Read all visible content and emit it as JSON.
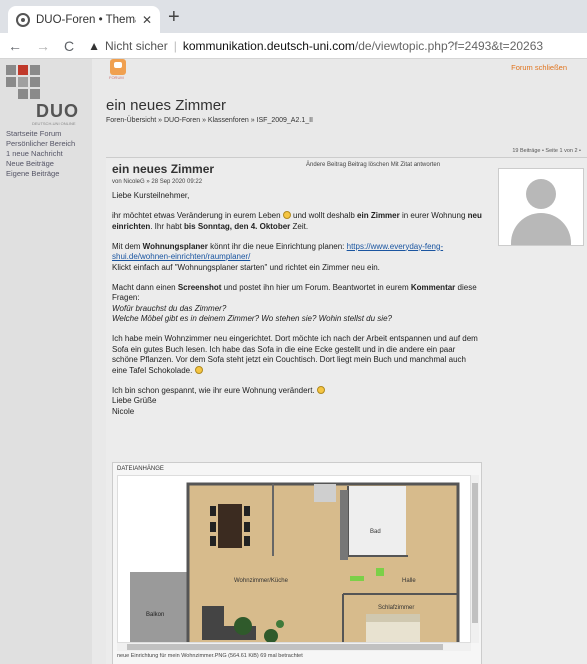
{
  "browser": {
    "tab_title": "DUO-Foren • Thema anzeigen - e",
    "tab_close": "✕",
    "new_tab": "+",
    "back": "←",
    "forward": "→",
    "reload": "C",
    "security_icon": "▲",
    "not_secure": "Nicht sicher",
    "separator": "|",
    "url_host": "kommunikation.deutsch-uni.com",
    "url_path": "/de/viewtopic.php?f=2493&t=20263"
  },
  "sidebar": {
    "logo_text": "DUO",
    "logo_sub": "DEUTSCH-UNI ONLINE",
    "items": [
      "Startseite Forum",
      "Persönlicher Bereich",
      "1 neue Nachricht",
      "Neue Beiträge",
      "Eigene Beiträge"
    ]
  },
  "header": {
    "forum_icon_label": "FORUM",
    "forum_close": "Forum schließen",
    "page_title": "ein neues Zimmer",
    "breadcrumb": "Foren-Übersicht » DUO-Foren » Klassenforen » ISF_2009_A2.1_II",
    "posts_count": "19 Beiträge • Seite 1 von 2 •"
  },
  "post": {
    "title": "ein neues Zimmer",
    "actions": "Ändere Beitrag Beitrag löschen   Mit Zitat antworten",
    "meta": "von NicoleG » 28 Sep 2020 09:22",
    "greeting": "Liebe Kursteilnehmer,",
    "p1_a": "ihr möchtet etwas Veränderung in eurem Leben ",
    "p1_b": " und wollt deshalb ",
    "p1_b_bold": "ein Zimmer",
    "p1_c": " in eurer Wohnung ",
    "p1_c_bold": "neu einrichten",
    "p1_d": ". Ihr habt ",
    "p1_d_bold": "bis Sonntag, den 4. Oktober",
    "p1_e": " Zeit.",
    "p2_a": "Mit dem ",
    "p2_bold": "Wohnungsplaner",
    "p2_b": " könnt ihr die neue Einrichtung planen: ",
    "p2_link": "https://www.everyday-feng-shui.de/wohnen-einrichten/raumplaner/",
    "p2_c": "Klickt einfach auf \"Wohnungsplaner starten\" und richtet ein Zimmer neu ein.",
    "p3_a": "Macht dann einen ",
    "p3_bold": "Screenshot",
    "p3_b": " und postet ihn hier um Forum. Beantwortet in eurem ",
    "p3_bold2": "Kommentar",
    "p3_c": " diese Fragen:",
    "p3_q1": "Wofür brauchst du das Zimmer?",
    "p3_q2": "Welche Möbel gibt es in deinem Zimmer? Wo stehen sie? Wohin stellst du sie?",
    "p4": "Ich habe mein Wohnzimmer neu eingerichtet. Dort möchte ich nach der Arbeit entspannen und auf dem Sofa ein gutes Buch lesen. Ich habe das Sofa in die eine Ecke gestellt und in die andere ein paar schöne Pflanzen. Vor dem Sofa steht jetzt ein Couchtisch. Dort liegt mein Buch und manchmal auch eine Tafel Schokolade. ",
    "p5": "Ich bin schon gespannt, wie ihr eure Wohnung verändert. ",
    "closing": "Liebe Grüße",
    "signature": "Nicole",
    "attachments_label": "DATEIANHÄNGE",
    "plan_labels": {
      "bad": "Bad",
      "wohn": "Wohnzimmer/Küche",
      "halle": "Halle",
      "schlaf": "Schlafzimmer",
      "balkon": "Balkon"
    },
    "caption": "neue Einrichtung für mein Wohnzimmer.PNG (564.61 KiB) 69 mal betrachtet"
  },
  "colors": {
    "accent": "#e0741e",
    "link": "#1a55a0",
    "logo_red": "#c0392b",
    "logo_gray": "#8a8a8a"
  }
}
